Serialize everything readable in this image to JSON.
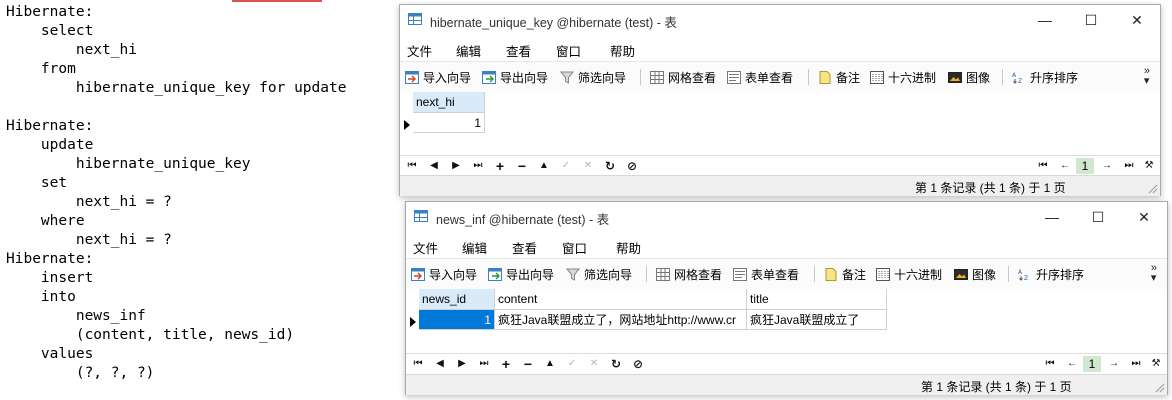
{
  "console": {
    "lines": [
      "Hibernate:",
      "    select",
      "        next_hi",
      "    from",
      "        hibernate_unique_key for update",
      "",
      "Hibernate:",
      "    update",
      "        hibernate_unique_key",
      "    set",
      "        next_hi = ?",
      "    where",
      "        next_hi = ?",
      "Hibernate:",
      "    insert",
      "    into",
      "        news_inf",
      "        (content, title, news_id)",
      "    values",
      "        (?, ?, ?)"
    ]
  },
  "window1": {
    "title": "hibernate_unique_key @hibernate (test) - 表",
    "menu": [
      "文件",
      "编辑",
      "查看",
      "窗口",
      "帮助"
    ],
    "toolbar": [
      "导入向导",
      "导出向导",
      "筛选向导",
      "网格查看",
      "表单查看",
      "备注",
      "十六进制",
      "图像",
      "升序排序"
    ],
    "columns": [
      "next_hi"
    ],
    "rows": [
      [
        "1"
      ]
    ],
    "page": "1",
    "status": "第 1 条记录 (共 1 条) 于 1 页"
  },
  "window2": {
    "title": "news_inf @hibernate (test) - 表",
    "menu": [
      "文件",
      "编辑",
      "查看",
      "窗口",
      "帮助"
    ],
    "toolbar": [
      "导入向导",
      "导出向导",
      "筛选向导",
      "网格查看",
      "表单查看",
      "备注",
      "十六进制",
      "图像",
      "升序排序"
    ],
    "columns": [
      "news_id",
      "content",
      "title"
    ],
    "rows": [
      [
        "1",
        "疯狂Java联盟成立了，网站地址http://www.cr",
        "疯狂Java联盟成立了"
      ]
    ],
    "page": "1",
    "status": "第 1 条记录 (共 1 条) 于 1 页"
  },
  "colors": {
    "selected_cell": "#0078d7",
    "header_selected": "#d9ebf9",
    "page_indicator": "#cfe8cf",
    "console_mark": "#d9534f"
  }
}
